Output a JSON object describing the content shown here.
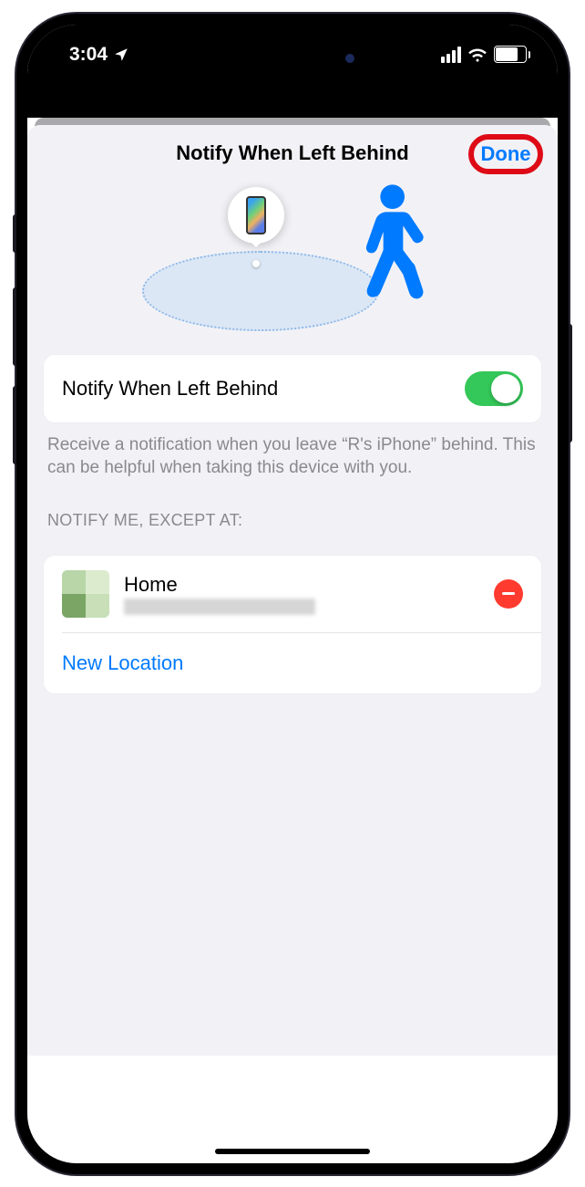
{
  "status_bar": {
    "time": "3:04",
    "battery_pct": "71"
  },
  "sheet": {
    "title": "Notify When Left Behind",
    "done_label": "Done"
  },
  "toggle_row": {
    "label": "Notify When Left Behind"
  },
  "description": "Receive a notification when you leave “R's iPhone” behind. This can be helpful when taking this device with you.",
  "except_section": {
    "header": "NOTIFY ME, EXCEPT AT:",
    "locations": [
      {
        "name": "Home"
      }
    ],
    "new_location_label": "New Location"
  }
}
